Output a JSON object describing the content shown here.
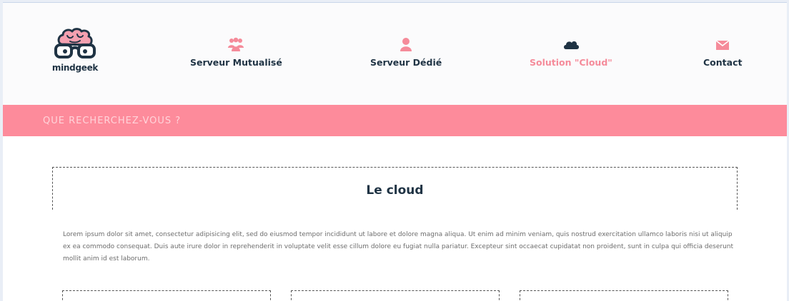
{
  "brand": {
    "name": "mindgeek"
  },
  "nav": [
    {
      "label": "Serveur Mutualisé",
      "icon": "users-icon"
    },
    {
      "label": "Serveur Dédié",
      "icon": "user-icon"
    },
    {
      "label": "Solution \"Cloud\"",
      "icon": "cloud-icon",
      "active": true
    },
    {
      "label": "Contact",
      "icon": "envelope-icon"
    }
  ],
  "search": {
    "placeholder": "QUE RECHERCHEZ-VOUS ?"
  },
  "main": {
    "title": "Le cloud",
    "intro": "Lorem ipsum dolor sit amet, consectetur adipisicing elit, sed do eiusmod tempor incididunt ut labore et dolore magna aliqua. Ut enim ad minim veniam, quis nostrud exercitation ullamco laboris nisi ut aliquip ex ea commodo consequat. Duis aute irure dolor in reprehenderit in voluptate velit esse cillum dolore eu fugiat nulla pariatur. Excepteur sint occaecat cupidatat non proident, sunt in culpa qui officia deserunt mollit anim id est laborum."
  },
  "colors": {
    "accent": "#fd8b9b",
    "active_nav": "#f58b9a",
    "dark": "#1f3344",
    "body_text": "#6d6d6d"
  }
}
